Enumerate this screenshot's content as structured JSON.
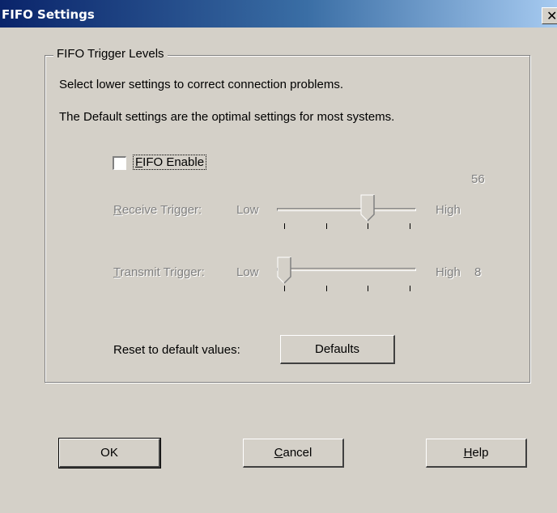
{
  "window": {
    "title": "FIFO Settings",
    "close": "✕"
  },
  "group": {
    "title": "FIFO Trigger Levels",
    "desc1": "Select lower settings to correct connection problems.",
    "desc2": "The Default settings are the optimal settings for most systems."
  },
  "fifo_enable": {
    "label_first": "F",
    "label_rest": "IFO Enable",
    "checked": false
  },
  "receive": {
    "label_first": "R",
    "label_rest": "eceive Trigger:",
    "low": "Low",
    "high": "High",
    "value": "56",
    "position_fraction": 0.67
  },
  "transmit": {
    "label_first": "T",
    "label_rest": "ransmit Trigger:",
    "low": "Low",
    "high": "High",
    "value": "8",
    "position_fraction": 0.0
  },
  "reset": {
    "label": "Reset to default values:",
    "button": "Defaults"
  },
  "buttons": {
    "ok": "OK",
    "cancel_first": "C",
    "cancel_rest": "ancel",
    "help_first": "H",
    "help_rest": "elp"
  },
  "icons": {
    "close": "close-icon",
    "receive_thumb": "slider-thumb-icon",
    "transmit_thumb": "slider-thumb-icon"
  }
}
